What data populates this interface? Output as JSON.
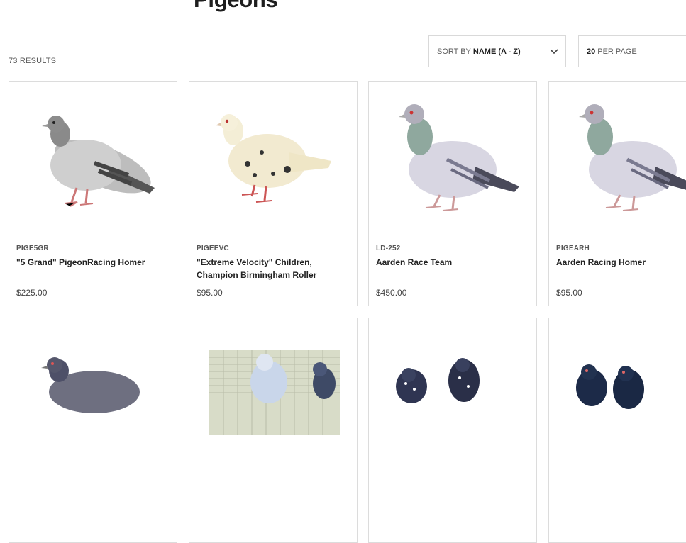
{
  "page": {
    "title": "Pigeons"
  },
  "results": {
    "count_label": "73 RESULTS"
  },
  "sort": {
    "prefix": "SORT BY",
    "value": "NAME (A - Z)"
  },
  "per_page": {
    "value": "20",
    "suffix": "PER PAGE"
  },
  "products": [
    {
      "sku": "PIGE5GR",
      "name": "\"5 Grand\" PigeonRacing Homer",
      "price": "$225.00",
      "image": "grey-pigeon"
    },
    {
      "sku": "PIGEEVC",
      "name": "\"Extreme Velocity\" Children, Champion Birmingham Roller",
      "price": "$95.00",
      "image": "cream-pigeon"
    },
    {
      "sku": "LD-252",
      "name": "Aarden Race Team",
      "price": "$450.00",
      "image": "blue-pigeon"
    },
    {
      "sku": "PIGEARH",
      "name": "Aarden Racing Homer",
      "price": "$95.00",
      "image": "blue-pigeon"
    },
    {
      "image": "dark-pigeon"
    },
    {
      "image": "pigeons-in-cage"
    },
    {
      "image": "speckled-pigeon-pair"
    },
    {
      "image": "black-pigeon-pair"
    }
  ],
  "colors": {
    "card_border": "#dcdcdc",
    "text": "#222222",
    "muted": "#5a5a5a"
  },
  "icons": {
    "sort_chevron": "chevron-down-icon"
  }
}
